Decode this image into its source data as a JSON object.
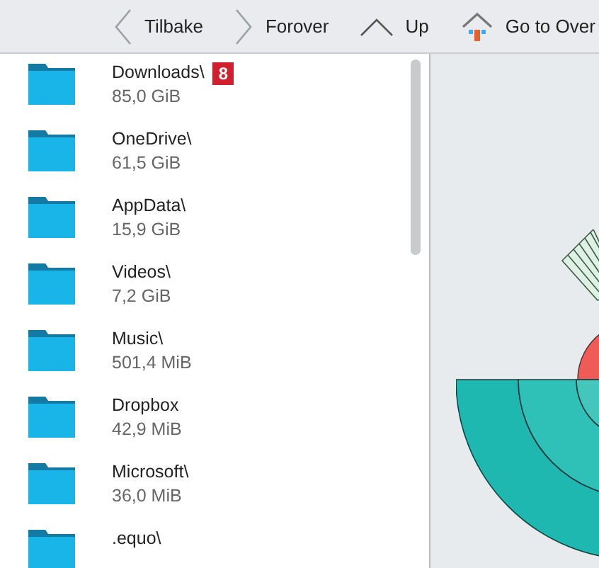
{
  "toolbar": [
    {
      "kind": "back",
      "label": "Tilbake"
    },
    {
      "kind": "forward",
      "label": "Forover"
    },
    {
      "kind": "up",
      "label": "Up"
    },
    {
      "kind": "home",
      "label": "Go to Over"
    }
  ],
  "folders": [
    {
      "name": "Downloads\\",
      "size": "85,0 GiB",
      "badge": "8"
    },
    {
      "name": "OneDrive\\",
      "size": "61,5 GiB"
    },
    {
      "name": "AppData\\",
      "size": "15,9 GiB"
    },
    {
      "name": "Videos\\",
      "size": "7,2 GiB"
    },
    {
      "name": "Music\\",
      "size": "501,4 MiB"
    },
    {
      "name": "Dropbox",
      "size": "42,9 MiB"
    },
    {
      "name": "Microsoft\\",
      "size": "36,0 MiB"
    },
    {
      "name": ".equo\\"
    }
  ]
}
